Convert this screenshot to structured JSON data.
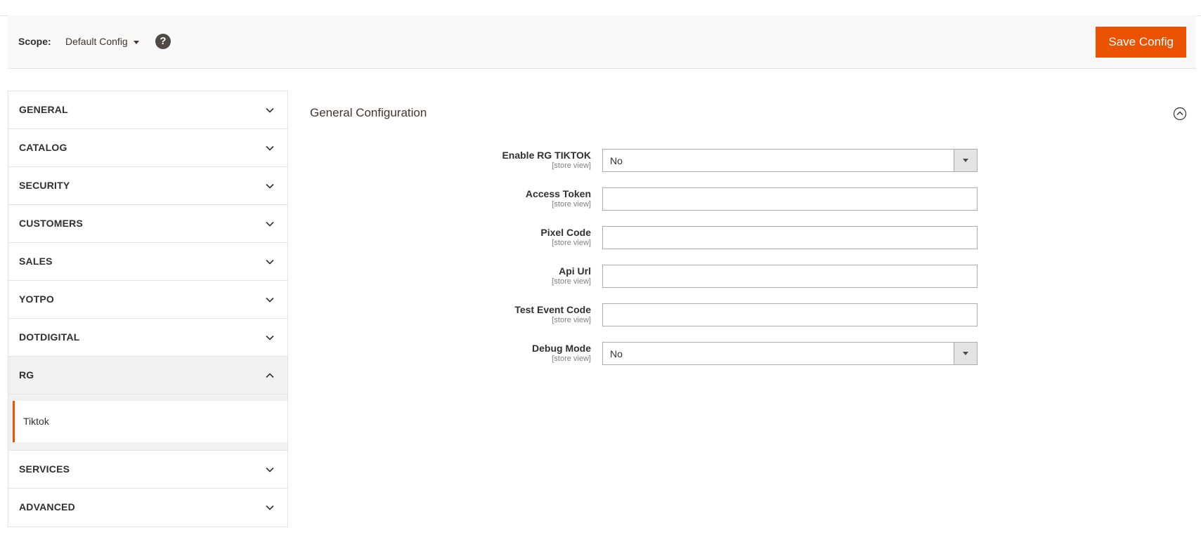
{
  "header": {
    "scope_label": "Scope:",
    "scope_value": "Default Config",
    "help_icon": "question-icon",
    "save_label": "Save Config"
  },
  "sidebar": {
    "items": [
      {
        "label": "GENERAL"
      },
      {
        "label": "CATALOG"
      },
      {
        "label": "SECURITY"
      },
      {
        "label": "CUSTOMERS"
      },
      {
        "label": "SALES"
      },
      {
        "label": "YOTPO"
      },
      {
        "label": "DOTDIGITAL"
      },
      {
        "label": "RG"
      },
      {
        "label": "SERVICES"
      },
      {
        "label": "ADVANCED"
      }
    ],
    "active_sub": {
      "label": "Tiktok"
    }
  },
  "main": {
    "section_title": "General Configuration",
    "fields": [
      {
        "label": "Enable RG TIKTOK",
        "scope": "[store view]",
        "type": "select",
        "value": "No"
      },
      {
        "label": "Access Token",
        "scope": "[store view]",
        "type": "text",
        "value": ""
      },
      {
        "label": "Pixel Code",
        "scope": "[store view]",
        "type": "text",
        "value": ""
      },
      {
        "label": "Api Url",
        "scope": "[store view]",
        "type": "text",
        "value": ""
      },
      {
        "label": "Test Event Code",
        "scope": "[store view]",
        "type": "text",
        "value": ""
      },
      {
        "label": "Debug Mode",
        "scope": "[store view]",
        "type": "select",
        "value": "No"
      }
    ]
  },
  "colors": {
    "accent": "#eb5202",
    "border": "#e3e3e3",
    "text": "#303030"
  }
}
